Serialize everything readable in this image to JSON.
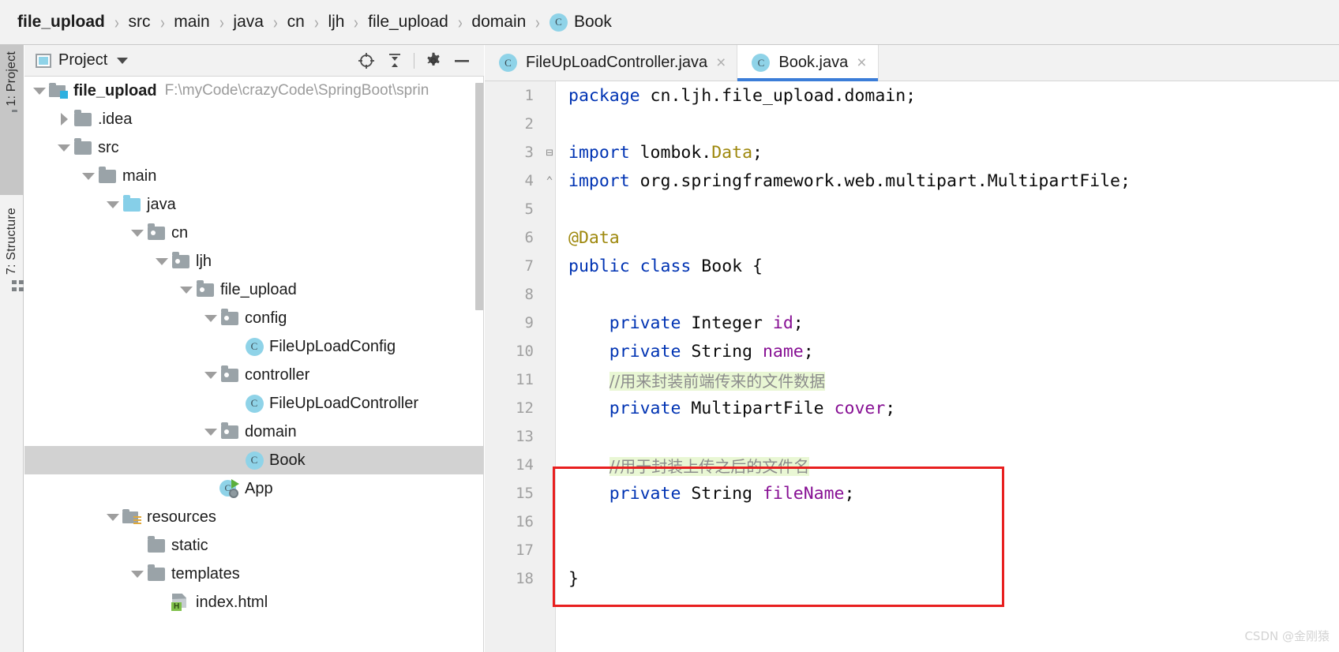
{
  "breadcrumb": {
    "name": "breadcrumb",
    "separator": "›",
    "items": [
      {
        "label": "file_upload",
        "bold": true,
        "icon": null
      },
      {
        "label": "src",
        "bold": false,
        "icon": null
      },
      {
        "label": "main",
        "bold": false,
        "icon": null
      },
      {
        "label": "java",
        "bold": false,
        "icon": null
      },
      {
        "label": "cn",
        "bold": false,
        "icon": null
      },
      {
        "label": "ljh",
        "bold": false,
        "icon": null
      },
      {
        "label": "file_upload",
        "bold": false,
        "icon": null
      },
      {
        "label": "domain",
        "bold": false,
        "icon": null
      },
      {
        "label": "Book",
        "bold": false,
        "icon": "class-icon",
        "icon_letter": "C"
      }
    ]
  },
  "toolstrip": {
    "buttons": [
      {
        "label": "1: Project",
        "icon": "folder-icon",
        "active": true
      },
      {
        "label": "7: Structure",
        "icon": "structure-icon",
        "active": false
      }
    ]
  },
  "project_panel": {
    "title": "Project",
    "title_icon": "project-view-icon",
    "dropdown_icon": "chevron-down-icon",
    "actions": [
      {
        "name": "locate-in-tree-button",
        "icon": "crosshair-icon"
      },
      {
        "name": "collapse-all-button",
        "icon": "collapse-all-icon"
      },
      {
        "name": "settings-button",
        "icon": "gear-icon"
      },
      {
        "name": "hide-panel-button",
        "icon": "minimize-icon"
      }
    ],
    "tree": [
      {
        "label": "file_upload",
        "path": "F:\\myCode\\crazyCode\\SpringBoot\\sprin",
        "depth": 0,
        "twist": "down",
        "icon": "module-icon",
        "bold": true,
        "selected": false
      },
      {
        "label": ".idea",
        "path": "",
        "depth": 1,
        "twist": "right",
        "icon": "folder-icon",
        "bold": false,
        "selected": false
      },
      {
        "label": "src",
        "path": "",
        "depth": 1,
        "twist": "down",
        "icon": "folder-icon",
        "bold": false,
        "selected": false
      },
      {
        "label": "main",
        "path": "",
        "depth": 2,
        "twist": "down",
        "icon": "folder-icon",
        "bold": false,
        "selected": false
      },
      {
        "label": "java",
        "path": "",
        "depth": 3,
        "twist": "down",
        "icon": "source-folder-icon",
        "bold": false,
        "selected": false
      },
      {
        "label": "cn",
        "path": "",
        "depth": 4,
        "twist": "down",
        "icon": "package-icon",
        "bold": false,
        "selected": false
      },
      {
        "label": "ljh",
        "path": "",
        "depth": 5,
        "twist": "down",
        "icon": "package-icon",
        "bold": false,
        "selected": false
      },
      {
        "label": "file_upload",
        "path": "",
        "depth": 6,
        "twist": "down",
        "icon": "package-icon",
        "bold": false,
        "selected": false
      },
      {
        "label": "config",
        "path": "",
        "depth": 7,
        "twist": "down",
        "icon": "package-icon",
        "bold": false,
        "selected": false
      },
      {
        "label": "FileUpLoadConfig",
        "path": "",
        "depth": 8,
        "twist": "none",
        "icon": "class-icon",
        "bold": false,
        "selected": false
      },
      {
        "label": "controller",
        "path": "",
        "depth": 7,
        "twist": "down",
        "icon": "package-icon",
        "bold": false,
        "selected": false
      },
      {
        "label": "FileUpLoadController",
        "path": "",
        "depth": 8,
        "twist": "none",
        "icon": "class-icon",
        "bold": false,
        "selected": false
      },
      {
        "label": "domain",
        "path": "",
        "depth": 7,
        "twist": "down",
        "icon": "package-icon",
        "bold": false,
        "selected": false
      },
      {
        "label": "Book",
        "path": "",
        "depth": 8,
        "twist": "none",
        "icon": "class-icon",
        "bold": false,
        "selected": true
      },
      {
        "label": "App",
        "path": "",
        "depth": 7,
        "twist": "none",
        "icon": "spring-app-icon",
        "bold": false,
        "selected": false
      },
      {
        "label": "resources",
        "path": "",
        "depth": 3,
        "twist": "down",
        "icon": "resources-folder-icon",
        "bold": false,
        "selected": false
      },
      {
        "label": "static",
        "path": "",
        "depth": 4,
        "twist": "none",
        "icon": "folder-icon",
        "bold": false,
        "selected": false
      },
      {
        "label": "templates",
        "path": "",
        "depth": 4,
        "twist": "down",
        "icon": "folder-icon",
        "bold": false,
        "selected": false
      },
      {
        "label": "index.html",
        "path": "",
        "depth": 5,
        "twist": "none",
        "icon": "html-file-icon",
        "bold": false,
        "selected": false
      }
    ]
  },
  "editor": {
    "tabs": [
      {
        "label": "FileUpLoadController.java",
        "icon": "class-icon",
        "icon_letter": "C",
        "active": false,
        "close_glyph": "×"
      },
      {
        "label": "Book.java",
        "icon": "class-icon",
        "icon_letter": "C",
        "active": true,
        "close_glyph": "×"
      }
    ],
    "lines": [
      {
        "num": "1",
        "fold": "",
        "segments": [
          {
            "t": "package",
            "c": "kw"
          },
          {
            "t": " cn.ljh.file_upload.domain;",
            "c": ""
          }
        ]
      },
      {
        "num": "2",
        "fold": "",
        "segments": []
      },
      {
        "num": "3",
        "fold": "⊟",
        "segments": [
          {
            "t": "import",
            "c": "kw"
          },
          {
            "t": " lombok.",
            "c": ""
          },
          {
            "t": "Data",
            "c": "ann"
          },
          {
            "t": ";",
            "c": ""
          }
        ]
      },
      {
        "num": "4",
        "fold": "⌃",
        "segments": [
          {
            "t": "import",
            "c": "kw"
          },
          {
            "t": " org.springframework.web.multipart.MultipartFile;",
            "c": ""
          }
        ]
      },
      {
        "num": "5",
        "fold": "",
        "segments": []
      },
      {
        "num": "6",
        "fold": "",
        "segments": [
          {
            "t": "@Data",
            "c": "ann"
          }
        ]
      },
      {
        "num": "7",
        "fold": "",
        "segments": [
          {
            "t": "public",
            "c": "kw"
          },
          {
            "t": " ",
            "c": ""
          },
          {
            "t": "class",
            "c": "kw"
          },
          {
            "t": " Book {",
            "c": ""
          }
        ]
      },
      {
        "num": "8",
        "fold": "",
        "segments": []
      },
      {
        "num": "9",
        "fold": "",
        "segments": [
          {
            "t": "    ",
            "c": ""
          },
          {
            "t": "private",
            "c": "kw"
          },
          {
            "t": " Integer ",
            "c": ""
          },
          {
            "t": "id",
            "c": "fld"
          },
          {
            "t": ";",
            "c": ""
          }
        ]
      },
      {
        "num": "10",
        "fold": "",
        "segments": [
          {
            "t": "    ",
            "c": ""
          },
          {
            "t": "private",
            "c": "kw"
          },
          {
            "t": " String ",
            "c": ""
          },
          {
            "t": "name",
            "c": "fld"
          },
          {
            "t": ";",
            "c": ""
          }
        ]
      },
      {
        "num": "11",
        "fold": "",
        "segments": [
          {
            "t": "    ",
            "c": ""
          },
          {
            "t": "//用来封装前端传来的文件数据",
            "c": "cmt cmt-cn"
          }
        ]
      },
      {
        "num": "12",
        "fold": "",
        "segments": [
          {
            "t": "    ",
            "c": ""
          },
          {
            "t": "private",
            "c": "kw"
          },
          {
            "t": " MultipartFile ",
            "c": ""
          },
          {
            "t": "cover",
            "c": "fld"
          },
          {
            "t": ";",
            "c": ""
          }
        ]
      },
      {
        "num": "13",
        "fold": "",
        "segments": []
      },
      {
        "num": "14",
        "fold": "",
        "segments": [
          {
            "t": "    ",
            "c": ""
          },
          {
            "t": "//用于封装上传之后的文件名",
            "c": "cmt cmt-cn"
          }
        ]
      },
      {
        "num": "15",
        "fold": "",
        "segments": [
          {
            "t": "    ",
            "c": ""
          },
          {
            "t": "private",
            "c": "kw"
          },
          {
            "t": " String ",
            "c": ""
          },
          {
            "t": "fileName",
            "c": "fld"
          },
          {
            "t": ";",
            "c": ""
          }
        ]
      },
      {
        "num": "16",
        "fold": "",
        "segments": []
      },
      {
        "num": "17",
        "fold": "",
        "segments": []
      },
      {
        "num": "18",
        "fold": "",
        "segments": [
          {
            "t": "}",
            "c": ""
          }
        ]
      }
    ],
    "annotation": {
      "name": "red-highlight-box",
      "color": "#e81f1f",
      "covers_lines": "13-16"
    }
  },
  "watermark": {
    "text": "CSDN @金刚猿"
  },
  "colors": {
    "accent": "#3b7dd8",
    "keyword": "#0033b3",
    "annotation": "#9e880d",
    "field": "#871094",
    "comment": "#8c8c8c",
    "comment_bg": "#e9f7d4",
    "selection": "#d2d2d2",
    "class_icon": "#8fd3e8",
    "annotation_box": "#e81f1f"
  }
}
